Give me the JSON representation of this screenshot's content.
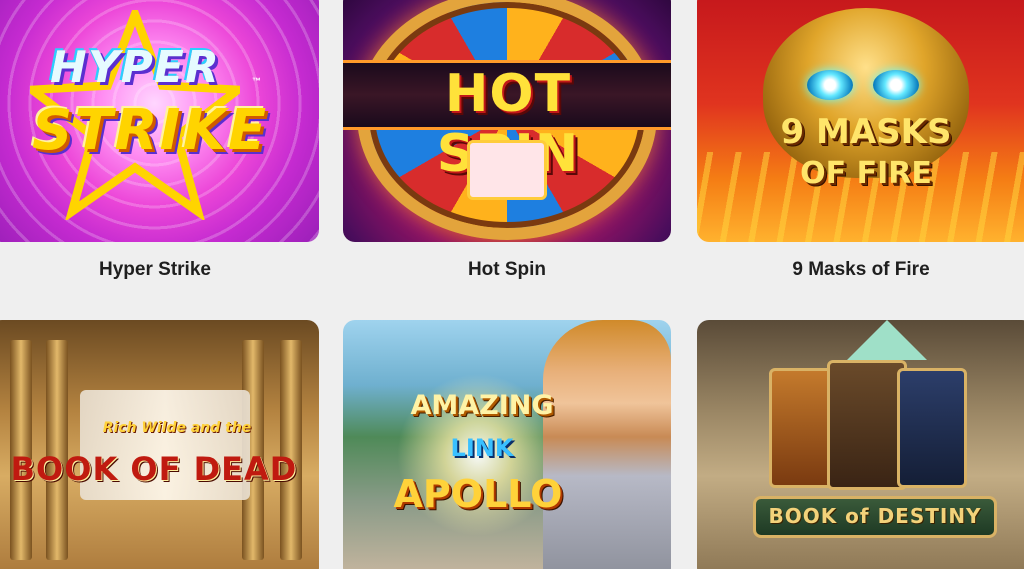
{
  "games": [
    {
      "title": "Hyper Strike",
      "logo": {
        "line1": "HYPER",
        "line2": "STRIKE",
        "tm": "™"
      }
    },
    {
      "title": "Hot Spin",
      "logo": {
        "text": "HOT SPIN"
      }
    },
    {
      "title": "9 Masks of Fire",
      "logo": {
        "line1": "9 MASKS",
        "line2": "OF FIRE"
      }
    },
    {
      "title": "",
      "logo": {
        "line1": "Rich Wilde and the",
        "line2": "BOOK OF DEAD"
      }
    },
    {
      "title": "",
      "logo": {
        "line1": "AMAZING",
        "line2": "LINK",
        "line3": "APOLLO"
      }
    },
    {
      "title": "",
      "logo": {
        "text": "BOOK of DESTINY"
      }
    }
  ]
}
